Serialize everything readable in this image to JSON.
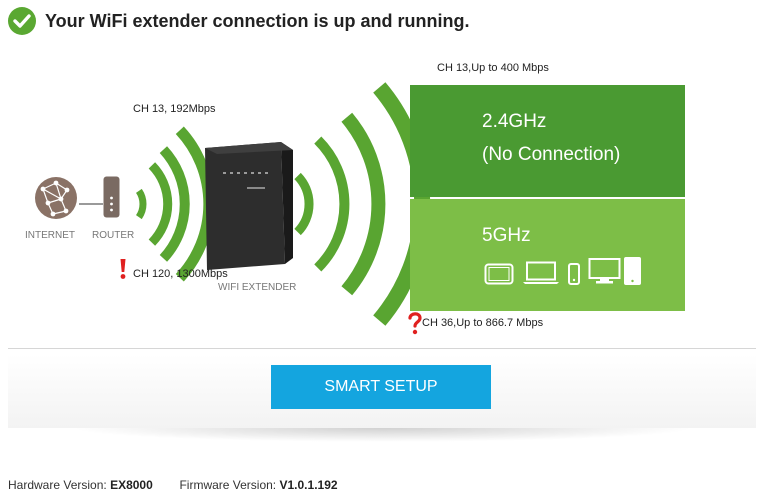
{
  "header": {
    "title": "Your WiFi extender connection is up and running."
  },
  "diagram": {
    "internet_label": "INTERNET",
    "router_label": "ROUTER",
    "extender_label": "WIFI EXTENDER",
    "router_link_24": "CH 13, 192Mbps",
    "router_link_5": "CH 120, 1300Mbps",
    "ext_link_24": "CH 13,Up to 400 Mbps",
    "ext_link_5": "CH 36,Up to 866.7 Mbps",
    "band_24": {
      "name": "2.4GHz",
      "status": "(No Connection)"
    },
    "band_5": {
      "name": "5GHz",
      "devices": [
        "tablet-icon",
        "laptop-icon",
        "phone-icon",
        "desktop-icon"
      ]
    }
  },
  "setup": {
    "button_label": "SMART SETUP"
  },
  "footer": {
    "hardware_label": "Hardware Version:",
    "hardware_value": "EX8000",
    "firmware_label": "Firmware Version:",
    "firmware_value": "V1.0.1.192"
  },
  "colors": {
    "green_dark": "#4a9a32",
    "green_light": "#7dbe47",
    "button_blue": "#14a5df",
    "check_green": "#5aa832",
    "alert_red": "#e0201f"
  }
}
